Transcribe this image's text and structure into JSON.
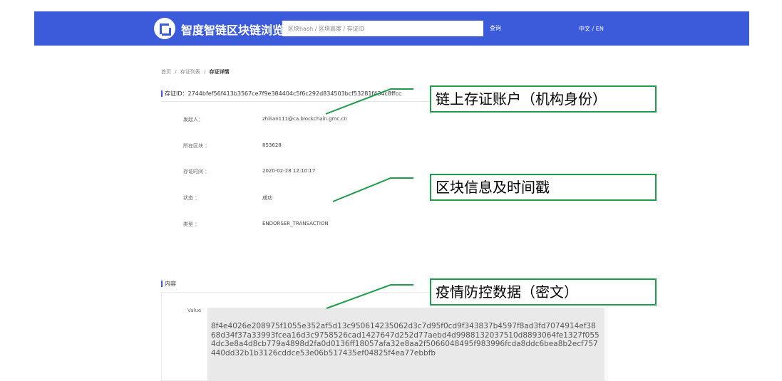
{
  "header": {
    "brand": "智度智链区块链浏览器",
    "search_placeholder": "区块hash / 区块高度 / 存证ID",
    "search_button": "查询",
    "lang": "中文 / EN"
  },
  "breadcrumb": {
    "home": "首页",
    "list": "存证列表",
    "current": "存证详情",
    "sep": "/"
  },
  "evidence": {
    "id_label": "存证ID：",
    "id_value": "2744bfef56f413b3567ce7f9e384404c5f6c292d834503bcf53281f434c8ffcc",
    "rows": [
      {
        "label": "发起人：",
        "value": "zhilian111@ca.blockchain.gmc.cn"
      },
      {
        "label": "所在区块 ：",
        "value": "853628"
      },
      {
        "label": "存证时间 ：",
        "value": "2020-02-28 12:10:17"
      },
      {
        "label": "状态 ：",
        "value": "成功"
      },
      {
        "label": "类型 ：",
        "value": "ENDORSER_TRANSACTION"
      }
    ]
  },
  "content": {
    "title": "内容",
    "value_label": "Value",
    "value": "8f4e4026e208975f1055e352af5d13c950614235062d3c7d95f0cd9f343837b4597f8ad3fd7074914ef3868d34f37a33993fcea16d3c9758526cad1427647d252d77aebd4d9988132037510d8893064fe1327f0554dc3e8a4d8cb779a4898d2fa0d0136ff18057afa32e8aa2f5066048495f983996fcda8ddc6bea8b2ecf757440dd32b1b3126cddce53e06b517435ef04825f4ea77ebbfb"
  },
  "callouts": [
    {
      "text": "链上存证账户（机构身份）"
    },
    {
      "text": "区块信息及时间戳"
    },
    {
      "text": "疫情防控数据（密文）"
    }
  ],
  "colors": {
    "header": "#3b5bdb",
    "callout_border": "#1f9d4d"
  }
}
